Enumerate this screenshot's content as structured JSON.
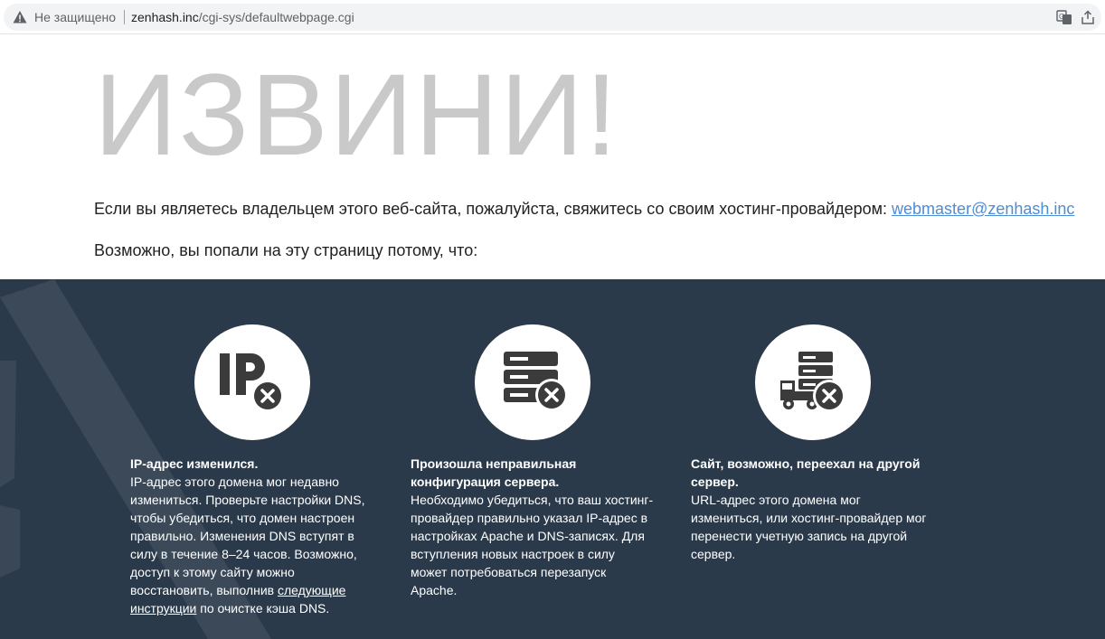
{
  "browser": {
    "security_label": "Не защищено",
    "url_host": "zenhash.inc",
    "url_path": "/cgi-sys/defaultwebpage.cgi"
  },
  "page": {
    "headline": "ИЗВИНИ!",
    "contact_text": "Если вы являетесь владельцем этого веб-сайта, пожалуйста, свяжитесь со своим хостинг-провайдером:",
    "contact_email": "webmaster@zenhash.inc",
    "reasons_intro": "Возможно, вы попали на эту страницу потому, что:"
  },
  "reasons": [
    {
      "icon": "ip-error-icon",
      "title": "IP-адрес изменился.",
      "body_before_link": "IP-адрес этого домена мог недавно измениться. Проверьте настройки DNS, чтобы убедиться, что домен настроен правильно. Изменения DNS вступят в силу в течение 8–24 часов. Возможно, доступ к этому сайту можно восстановить, выполнив ",
      "link_text": "следующие инструкции",
      "body_after_link": " по очистке кэша DNS."
    },
    {
      "icon": "server-error-icon",
      "title": "Произошла неправильная конфигурация сервера.",
      "body": "Необходимо убедиться, что ваш хостинг-провайдер правильно указал IP-адрес в настройках Apache и DNS-записях. Для вступления новых настроек в силу может потребоваться перезапуск Apache."
    },
    {
      "icon": "server-moved-icon",
      "title": "Сайт, возможно, переехал на другой сервер.",
      "body": "URL-адрес этого домена мог измениться, или хостинг-провайдер мог перенести учетную запись на другой сервер."
    }
  ],
  "colors": {
    "panel_bg": "#2b3a4a",
    "headline": "#c9c9c9",
    "link": "#4c8dd6",
    "icon_dark": "#3b3b3b"
  }
}
